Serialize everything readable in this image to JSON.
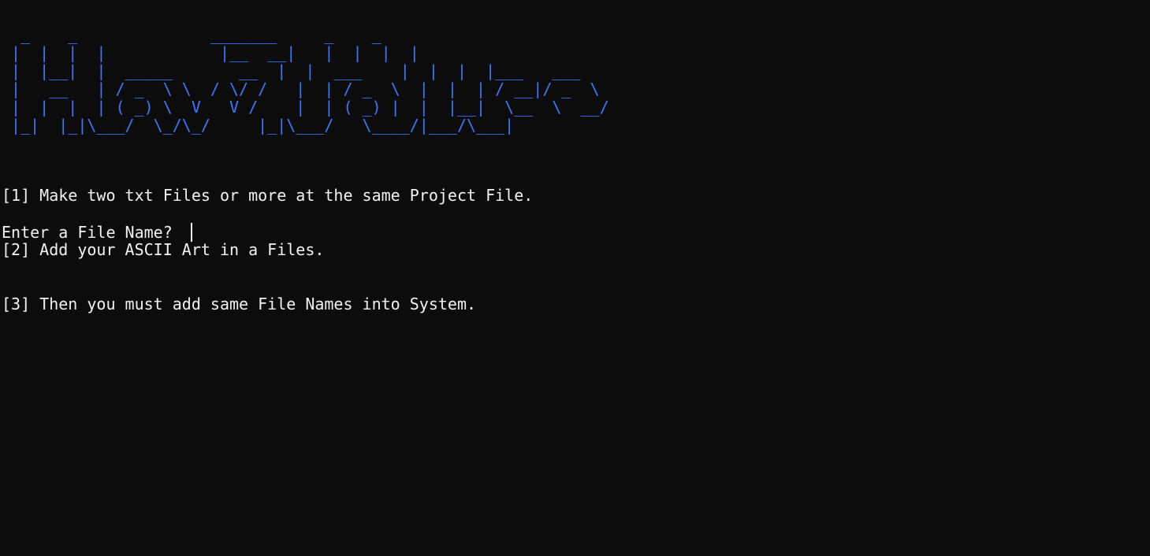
{
  "banner": {
    "ascii_art": "  _    _              _______     _    _\n |  |  |  |            |__  __|   |  |  |  |\n |  |__|  |  _____       __  |  |  ___    |  |  |  |___   ___\n |   __   | / _  \\ \\  / \\/ /   |  | / _  \\  |  |  | / __|/ _  \\\n |  |  |  | ( _) \\  V   V /    |  | ( _) |  |  |__|  \\__  \\  __/\n |_|  |_|\\___/  \\_/\\_/     |_|\\___/   \\____/|___/\\___|",
    "color": "#3b78ff"
  },
  "instructions": [
    "[1] Make two txt Files or more at the same Project File.",
    "[2] Add your ASCII Art in a Files.",
    "[3] Then you must add same File Names into System."
  ],
  "prompt": {
    "label": "Enter a File Name? ",
    "value": ""
  }
}
